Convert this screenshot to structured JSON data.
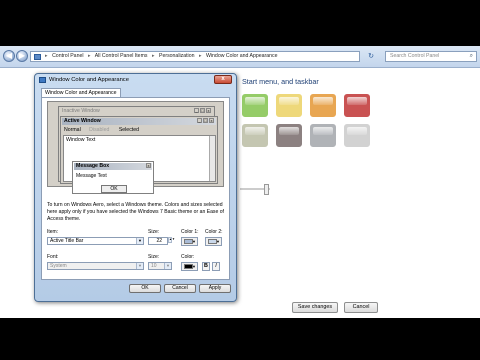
{
  "explorer": {
    "breadcrumb": [
      "Control Panel",
      "All Control Panel Items",
      "Personalization",
      "Window Color and Appearance"
    ],
    "separator": "▸",
    "search_placeholder": "Search Control Panel",
    "back_glyph": "◀",
    "forward_glyph": "▶",
    "refresh_glyph": "↻"
  },
  "background": {
    "heading": "Start menu, and taskbar",
    "swatch_colors": [
      "#8fcf5a",
      "#f2d86a",
      "#f2a542",
      "#d94e4e",
      "#c4c6ae",
      "#8d8180",
      "#b0b3b8",
      "#d2d2d2"
    ],
    "save_label": "Save changes",
    "cancel_label": "Cancel"
  },
  "dialog": {
    "title": "Window Color and Appearance",
    "close_glyph": "x",
    "tab_label": "Window Color and Appearance",
    "preview": {
      "inactive_title": "Inactive Window",
      "active_title": "Active Window",
      "menu_normal": "Normal",
      "menu_disabled": "Disabled",
      "menu_selected": "Selected",
      "window_text": "Window Text",
      "message_title": "Message Box",
      "message_text": "Message Text",
      "ok_label": "OK"
    },
    "description": "To turn on Windows Aero, select a Windows theme.  Colors and sizes selected here apply only if you have selected the Windows 7 Basic theme or an Ease of Access theme.",
    "item_label": "Item:",
    "item_value": "Active Title Bar",
    "size_label": "Size:",
    "item_size": "22",
    "color1_label": "Color 1:",
    "color2_label": "Color 2:",
    "color1_value": "#a9bbd6",
    "color2_value": "#cad8ea",
    "font_label": "Font:",
    "font_value": "System",
    "font_size_label": "Size:",
    "font_size": "10",
    "font_color_label": "Color:",
    "font_color_value": "#000000",
    "bold_label": "B",
    "italic_label": "I",
    "ok_label": "OK",
    "cancel_label": "Cancel",
    "apply_label": "Apply"
  }
}
